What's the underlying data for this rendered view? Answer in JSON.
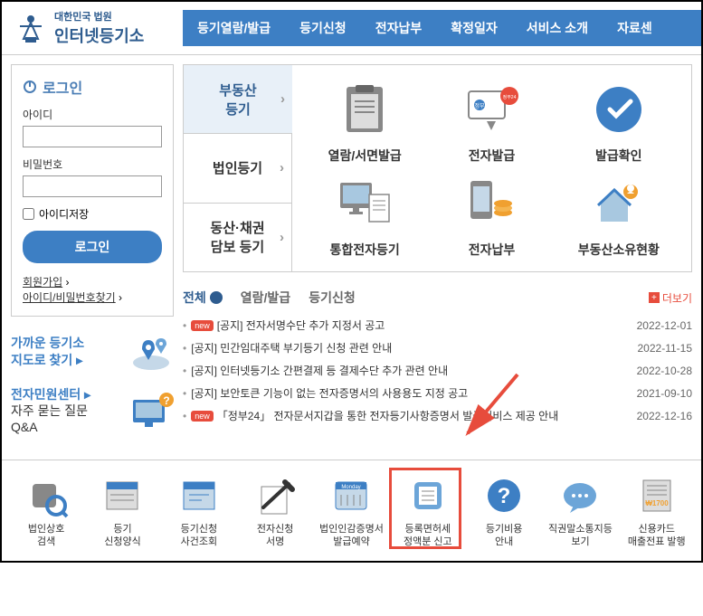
{
  "header": {
    "logo_small": "대한민국 법원",
    "logo_large": "인터넷등기소",
    "nav": [
      "등기열람/발급",
      "등기신청",
      "전자납부",
      "확정일자",
      "서비스 소개",
      "자료센"
    ]
  },
  "login": {
    "title": "로그인",
    "id_label": "아이디",
    "pw_label": "비밀번호",
    "remember_label": "아이디저장",
    "button": "로그인",
    "link_signup": "회원가입",
    "link_find": "아이디/비밀번호찾기"
  },
  "quicklinks": {
    "nearby": {
      "line1": "가까운 등기소",
      "line2": "지도로 찾기"
    },
    "center": {
      "line1": "전자민원센터",
      "line2a": "자주 묻는 질문",
      "line2b": "Q&A"
    }
  },
  "services": {
    "tabs": [
      "부동산\n등기",
      "법인등기",
      "동산·채권\n담보 등기"
    ],
    "items": [
      {
        "label": "열람/서면발급"
      },
      {
        "label": "전자발급"
      },
      {
        "label": "발급확인"
      },
      {
        "label": "통합전자등기"
      },
      {
        "label": "전자납부"
      },
      {
        "label": "부동산소유현황"
      }
    ]
  },
  "notice": {
    "tabs": [
      "전체",
      "열람/발급",
      "등기신청"
    ],
    "more": "더보기",
    "items": [
      {
        "new": true,
        "title": "[공지] 전자서명수단 추가 지정서 공고",
        "date": "2022-12-01"
      },
      {
        "new": false,
        "title": "[공지] 민간임대주택 부기등기 신청 관련 안내",
        "date": "2022-11-15"
      },
      {
        "new": false,
        "title": "[공지] 인터넷등기소 간편결제 등 결제수단 추가 관련 안내",
        "date": "2022-10-28"
      },
      {
        "new": false,
        "title": "[공지] 보안토큰 기능이 없는 전자증명서의 사용용도 지정 공고",
        "date": "2021-09-10"
      },
      {
        "new": true,
        "title": "「정부24」 전자문서지갑을 통한 전자등기사항증명서 발급서비스 제공 안내",
        "date": "2022-12-16"
      }
    ]
  },
  "bottom": [
    {
      "line1": "법인상호",
      "line2": "검색"
    },
    {
      "line1": "등기",
      "line2": "신청양식"
    },
    {
      "line1": "등기신청",
      "line2": "사건조회"
    },
    {
      "line1": "전자신청",
      "line2": "서명"
    },
    {
      "line1": "법인인감증명서",
      "line2": "발급예약"
    },
    {
      "line1": "등록면허세",
      "line2": "정액분 신고"
    },
    {
      "line1": "등기비용",
      "line2": "안내"
    },
    {
      "line1": "직권말소통지등",
      "line2": "보기"
    },
    {
      "line1": "신용카드",
      "line2": "매출전표 발행"
    }
  ]
}
